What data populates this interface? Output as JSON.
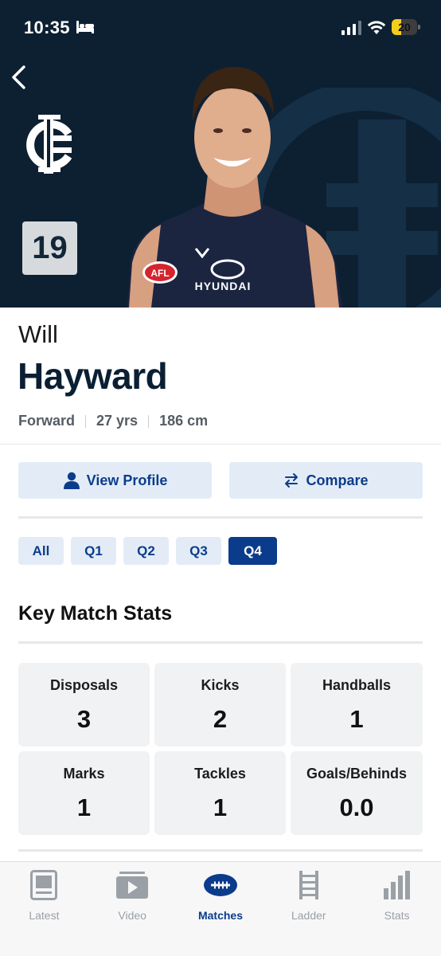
{
  "status_bar": {
    "time": "10:35",
    "battery_level": "20",
    "icons": [
      "bed-icon",
      "cellular-signal-icon",
      "wifi-icon",
      "battery-icon"
    ]
  },
  "header": {
    "back_icon": "chevron-left-icon",
    "club_logo": "carlton-logo",
    "jersey_number": "19",
    "background_color": "#0d2032"
  },
  "player": {
    "first_name": "Will",
    "last_name": "Hayward",
    "position": "Forward",
    "age": "27 yrs",
    "height": "186 cm"
  },
  "actions": {
    "view_profile": "View Profile",
    "view_profile_icon": "person-icon",
    "compare": "Compare",
    "compare_icon": "swap-arrows-icon"
  },
  "quarter_tabs": {
    "items": [
      "All",
      "Q1",
      "Q2",
      "Q3",
      "Q4"
    ],
    "selected": "Q4"
  },
  "key_stats": {
    "title": "Key Match Stats",
    "items": [
      {
        "label": "Disposals",
        "value": "3"
      },
      {
        "label": "Kicks",
        "value": "2"
      },
      {
        "label": "Handballs",
        "value": "1"
      },
      {
        "label": "Marks",
        "value": "1"
      },
      {
        "label": "Tackles",
        "value": "1"
      },
      {
        "label": "Goals/Behinds",
        "value": "0.0"
      }
    ]
  },
  "tabbar": {
    "items": [
      {
        "label": "Latest",
        "icon": "news-icon"
      },
      {
        "label": "Video",
        "icon": "play-icon"
      },
      {
        "label": "Matches",
        "icon": "football-icon"
      },
      {
        "label": "Ladder",
        "icon": "ladder-icon"
      },
      {
        "label": "Stats",
        "icon": "bar-chart-icon"
      }
    ],
    "selected": "Matches"
  },
  "colors": {
    "accent": "#0b3c8c",
    "tab_inactive": "#9aa0a6",
    "battery": "#f3cd1c"
  }
}
